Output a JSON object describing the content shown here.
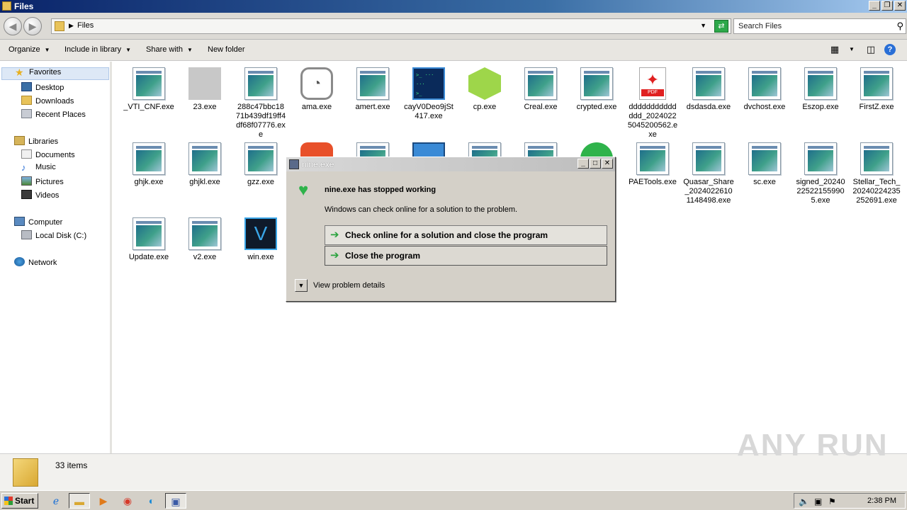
{
  "window": {
    "title": "Files"
  },
  "address": {
    "path": "Files",
    "search_placeholder": "Search Files"
  },
  "toolbar": {
    "organize": "Organize",
    "include_in_library": "Include in library",
    "share_with": "Share with",
    "new_folder": "New folder"
  },
  "nav": {
    "favorites": "Favorites",
    "desktop": "Desktop",
    "downloads": "Downloads",
    "recent_places": "Recent Places",
    "libraries": "Libraries",
    "documents": "Documents",
    "music": "Music",
    "pictures": "Pictures",
    "videos": "Videos",
    "computer": "Computer",
    "local_disk": "Local Disk (C:)",
    "network": "Network"
  },
  "files": [
    {
      "name": "_VTI_CNF.exe",
      "icon": "exe-icon"
    },
    {
      "name": "23.exe",
      "icon": "blank-icon"
    },
    {
      "name": "288c47bbc1871b439df19ff4df68f07776.exe",
      "icon": "exe-icon"
    },
    {
      "name": "ama.exe",
      "icon": "gauge-icon"
    },
    {
      "name": "amert.exe",
      "icon": "exe-icon"
    },
    {
      "name": "cayV0Deo9jSt417.exe",
      "icon": "terminal-icon"
    },
    {
      "name": "cp.exe",
      "icon": "cube-icon"
    },
    {
      "name": "Creal.exe",
      "icon": "exe-icon"
    },
    {
      "name": "crypted.exe",
      "icon": "exe-icon"
    },
    {
      "name": "dddddddddddddd_20240225045200562.exe",
      "icon": "pdf-icon"
    },
    {
      "name": "dsdasda.exe",
      "icon": "exe-icon"
    },
    {
      "name": "dvchost.exe",
      "icon": "exe-icon"
    },
    {
      "name": "Eszop.exe",
      "icon": "exe-icon"
    },
    {
      "name": "FirstZ.exe",
      "icon": "exe-icon"
    },
    {
      "name": "ghjk.exe",
      "icon": "exe-icon"
    },
    {
      "name": "ghjkl.exe",
      "icon": "exe-icon"
    },
    {
      "name": "gzz.exe",
      "icon": "exe-icon"
    },
    {
      "name": "PAETools.exe",
      "icon": "exe-icon"
    },
    {
      "name": "Quasar_Share_20240226101148498.exe",
      "icon": "exe-icon"
    },
    {
      "name": "sc.exe",
      "icon": "exe-icon"
    },
    {
      "name": "signed_20240225221559905.exe",
      "icon": "exe-icon"
    },
    {
      "name": "Stellar_Tech_20240224235252691.exe",
      "icon": "exe-icon"
    },
    {
      "name": "Update.exe",
      "icon": "exe-icon"
    },
    {
      "name": "v2.exe",
      "icon": "exe-icon"
    },
    {
      "name": "win.exe",
      "icon": "v-app-icon"
    }
  ],
  "status": {
    "count": "33 items"
  },
  "dialog": {
    "title": "nine.exe",
    "heading": "nine.exe has stopped working",
    "subtext": "Windows can check online for a solution to the problem.",
    "option_check": "Check online for a solution and close the program",
    "option_close": "Close the program",
    "details": "View problem details"
  },
  "taskbar": {
    "start": "Start",
    "clock": "2:38 PM"
  },
  "watermark": "ANY RUN",
  "colors": {
    "title_blue": "#0a246a",
    "accent_green": "#2fb34b"
  }
}
